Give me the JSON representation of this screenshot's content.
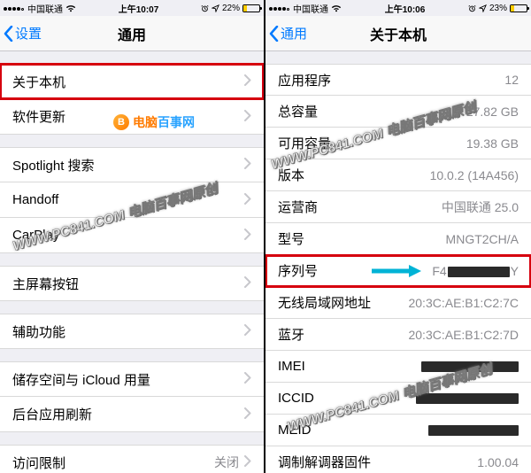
{
  "left": {
    "status": {
      "carrier": "中国联通",
      "time": "上午10:07",
      "battery_pct": "22%"
    },
    "nav": {
      "back": "设置",
      "title": "通用"
    },
    "groups": [
      [
        {
          "label": "关于本机",
          "chevron": true,
          "highlight": true
        },
        {
          "label": "软件更新",
          "chevron": true
        }
      ],
      [
        {
          "label": "Spotlight 搜索",
          "chevron": true
        },
        {
          "label": "Handoff",
          "chevron": true
        },
        {
          "label": "CarPlay",
          "chevron": true
        }
      ],
      [
        {
          "label": "主屏幕按钮",
          "chevron": true
        }
      ],
      [
        {
          "label": "辅助功能",
          "chevron": true
        }
      ],
      [
        {
          "label": "储存空间与 iCloud 用量",
          "chevron": true
        },
        {
          "label": "后台应用刷新",
          "chevron": true
        }
      ],
      [
        {
          "label": "访问限制",
          "value": "关闭",
          "chevron": true
        }
      ]
    ],
    "logo": {
      "icon": "B",
      "text1": "电脑",
      "text2": "百事网"
    },
    "watermark": "WWW.PC841.COM 电脑百事网原创"
  },
  "right": {
    "status": {
      "carrier": "中国联通",
      "time": "上午10:06",
      "battery_pct": "23%"
    },
    "nav": {
      "back": "通用",
      "title": "关于本机"
    },
    "rows": [
      {
        "label": "应用程序",
        "value": "12"
      },
      {
        "label": "总容量",
        "value": "27.82 GB"
      },
      {
        "label": "可用容量",
        "value": "19.38 GB"
      },
      {
        "label": "版本",
        "value": "10.0.2 (14A456)"
      },
      {
        "label": "运营商",
        "value": "中国联通 25.0"
      },
      {
        "label": "型号",
        "value": "MNGT2CH/A"
      },
      {
        "label": "序列号",
        "value_prefix": "F4",
        "value_suffix": "Y",
        "highlight": true,
        "arrow": true,
        "redact_w": 70
      },
      {
        "label": "无线局域网地址",
        "value": "20:3C:AE:B1:C2:7C"
      },
      {
        "label": "蓝牙",
        "value": "20:3C:AE:B1:C2:7D"
      },
      {
        "label": "IMEI",
        "redact_w": 110
      },
      {
        "label": "ICCID",
        "redact_w": 116
      },
      {
        "label": "MEID",
        "redact_w": 102
      },
      {
        "label": "调制解调器固件",
        "value": "1.00.04"
      }
    ],
    "watermark": "WWW.PC841.COM 电脑百事网原创"
  }
}
